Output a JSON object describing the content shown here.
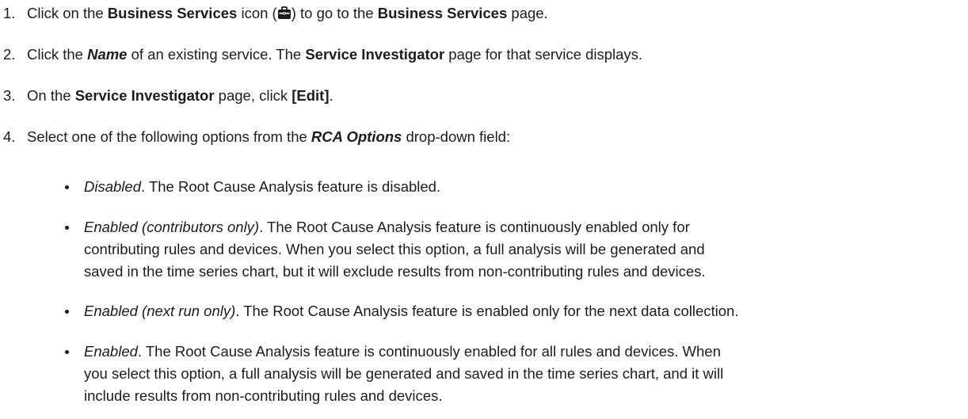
{
  "steps": [
    {
      "num": "1.",
      "t1": "Click on the ",
      "b1": "Business Services",
      "t2": " icon (",
      "icon": "briefcase-icon",
      "t3": ") to go to the ",
      "b2": "Business Services",
      "t4": " page."
    },
    {
      "num": "2.",
      "t1": "Click the ",
      "bi1": "Name",
      "t2": " of an existing service. The ",
      "b1": "Service Investigator",
      "t3": " page for that service displays."
    },
    {
      "num": "3.",
      "t1": "On the ",
      "b1": "Service Investigator",
      "t2": " page, click ",
      "b2": "[Edit]",
      "t3": "."
    },
    {
      "num": "4.",
      "t1": "Select one of the following options from the ",
      "bi1": "RCA Options",
      "t2": " drop-down field:"
    }
  ],
  "options": [
    {
      "name": "Disabled",
      "lines": [
        ". The Root Cause Analysis feature is disabled."
      ]
    },
    {
      "name": "Enabled (contributors only)",
      "lines": [
        ". The Root Cause Analysis feature is continuously enabled only for",
        "contributing rules and devices. When you select this option, a full analysis will be generated and",
        "saved in the time series chart, but it will exclude results from non-contributing rules and devices."
      ]
    },
    {
      "name": "Enabled (next run only)",
      "lines": [
        ". The Root Cause Analysis feature is enabled only for the next data collection."
      ]
    },
    {
      "name": "Enabled",
      "lines": [
        ". The Root Cause Analysis feature is continuously enabled for all rules and devices. When",
        "you select this option, a full analysis will be generated and saved in the time series chart, and it will",
        "include results from non-contributing rules and devices."
      ]
    }
  ]
}
